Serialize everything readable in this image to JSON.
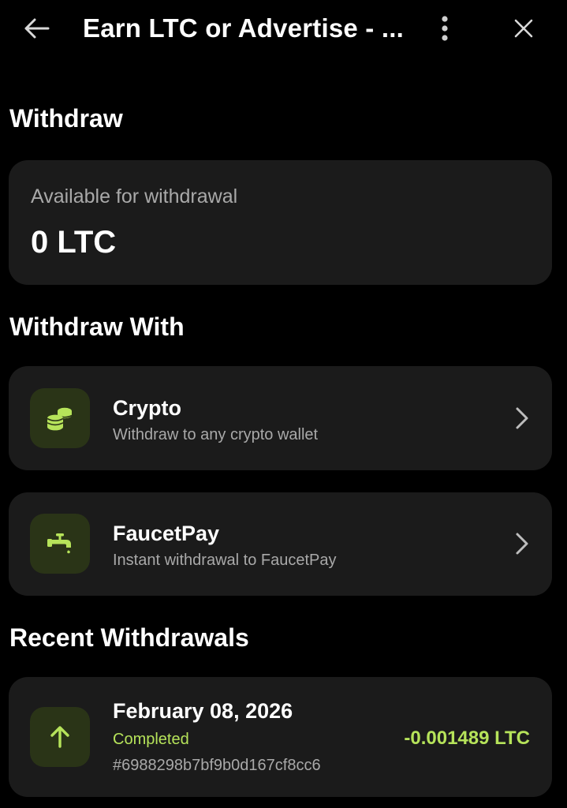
{
  "header": {
    "title": "Earn LTC or Advertise - ...",
    "back_icon": "arrow-left-icon",
    "menu_icon": "more-vertical-icon",
    "close_icon": "close-icon"
  },
  "withdraw": {
    "heading": "Withdraw",
    "balance_label": "Available for withdrawal",
    "balance_value": "0 LTC"
  },
  "withdraw_with": {
    "heading": "Withdraw With",
    "methods": [
      {
        "title": "Crypto",
        "subtitle": "Withdraw to any crypto wallet",
        "icon": "coins-icon"
      },
      {
        "title": "FaucetPay",
        "subtitle": "Instant withdrawal to FaucetPay",
        "icon": "faucet-icon"
      }
    ]
  },
  "recent": {
    "heading": "Recent Withdrawals",
    "items": [
      {
        "date": "February 08, 2026",
        "status": "Completed",
        "id": "#6988298b7bf9b0d167cf8cc6",
        "amount": "-0.001489 LTC",
        "icon": "arrow-up-icon"
      }
    ]
  },
  "colors": {
    "background": "#000000",
    "card": "#1b1b1b",
    "accent": "#b6e35a",
    "icon_bg": "#2a3417",
    "muted_text": "#a9a9a9"
  }
}
